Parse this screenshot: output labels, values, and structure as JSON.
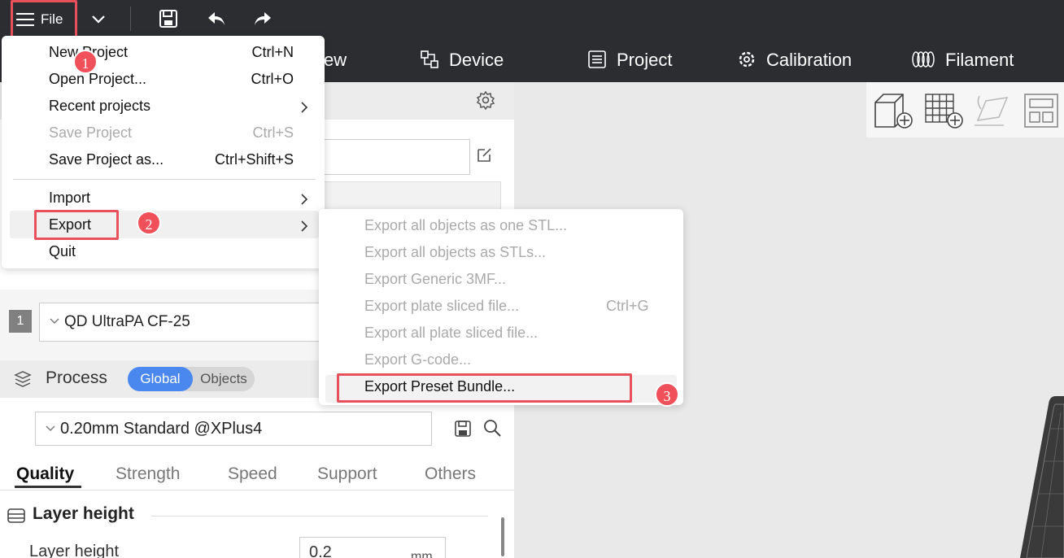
{
  "toolbar": {
    "file_label": "File"
  },
  "tabs": [
    {
      "label": "ew",
      "icon": "prepare-icon"
    },
    {
      "label": "Device",
      "icon": "device-icon"
    },
    {
      "label": "Project",
      "icon": "project-icon"
    },
    {
      "label": "Calibration",
      "icon": "calibration-icon"
    },
    {
      "label": "Filament",
      "icon": "filament-icon"
    }
  ],
  "file_menu": {
    "items": [
      {
        "label": "New Project",
        "shortcut": "Ctrl+N",
        "enabled": true
      },
      {
        "label": "Open Project...",
        "shortcut": "Ctrl+O",
        "enabled": true
      },
      {
        "label": "Recent projects",
        "submenu": true,
        "enabled": true
      },
      {
        "label": "Save Project",
        "shortcut": "Ctrl+S",
        "enabled": false
      },
      {
        "label": "Save Project as...",
        "shortcut": "Ctrl+Shift+S",
        "enabled": true
      },
      {
        "label": "Import",
        "submenu": true,
        "enabled": true
      },
      {
        "label": "Export",
        "submenu": true,
        "enabled": true
      },
      {
        "label": "Quit",
        "enabled": true
      }
    ]
  },
  "export_menu": {
    "items": [
      {
        "label": "Export all objects as one STL...",
        "enabled": false
      },
      {
        "label": "Export all objects as STLs...",
        "enabled": false
      },
      {
        "label": "Export Generic 3MF...",
        "enabled": false
      },
      {
        "label": "Export plate sliced file...",
        "shortcut": "Ctrl+G",
        "enabled": false
      },
      {
        "label": "Export all plate sliced file...",
        "enabled": false
      },
      {
        "label": "Export G-code...",
        "enabled": false
      },
      {
        "label": "Export Preset Bundle...",
        "enabled": true
      }
    ]
  },
  "callouts": [
    "1",
    "2",
    "3"
  ],
  "filament": {
    "index": "1",
    "name": "QD UltraPA CF-25"
  },
  "process": {
    "label": "Process",
    "global_label": "Global",
    "objects_label": "Objects",
    "preset": "0.20mm Standard @XPlus4",
    "subtabs": [
      "Quality",
      "Strength",
      "Speed",
      "Support",
      "Others"
    ],
    "section_title": "Layer height",
    "field_label": "Layer height",
    "field_value": "0.2",
    "field_unit": "mm"
  },
  "colors": {
    "toolbar_bg": "#2b2d30",
    "accent_blue": "#4a88f0",
    "highlight_red": "#e8505b"
  }
}
